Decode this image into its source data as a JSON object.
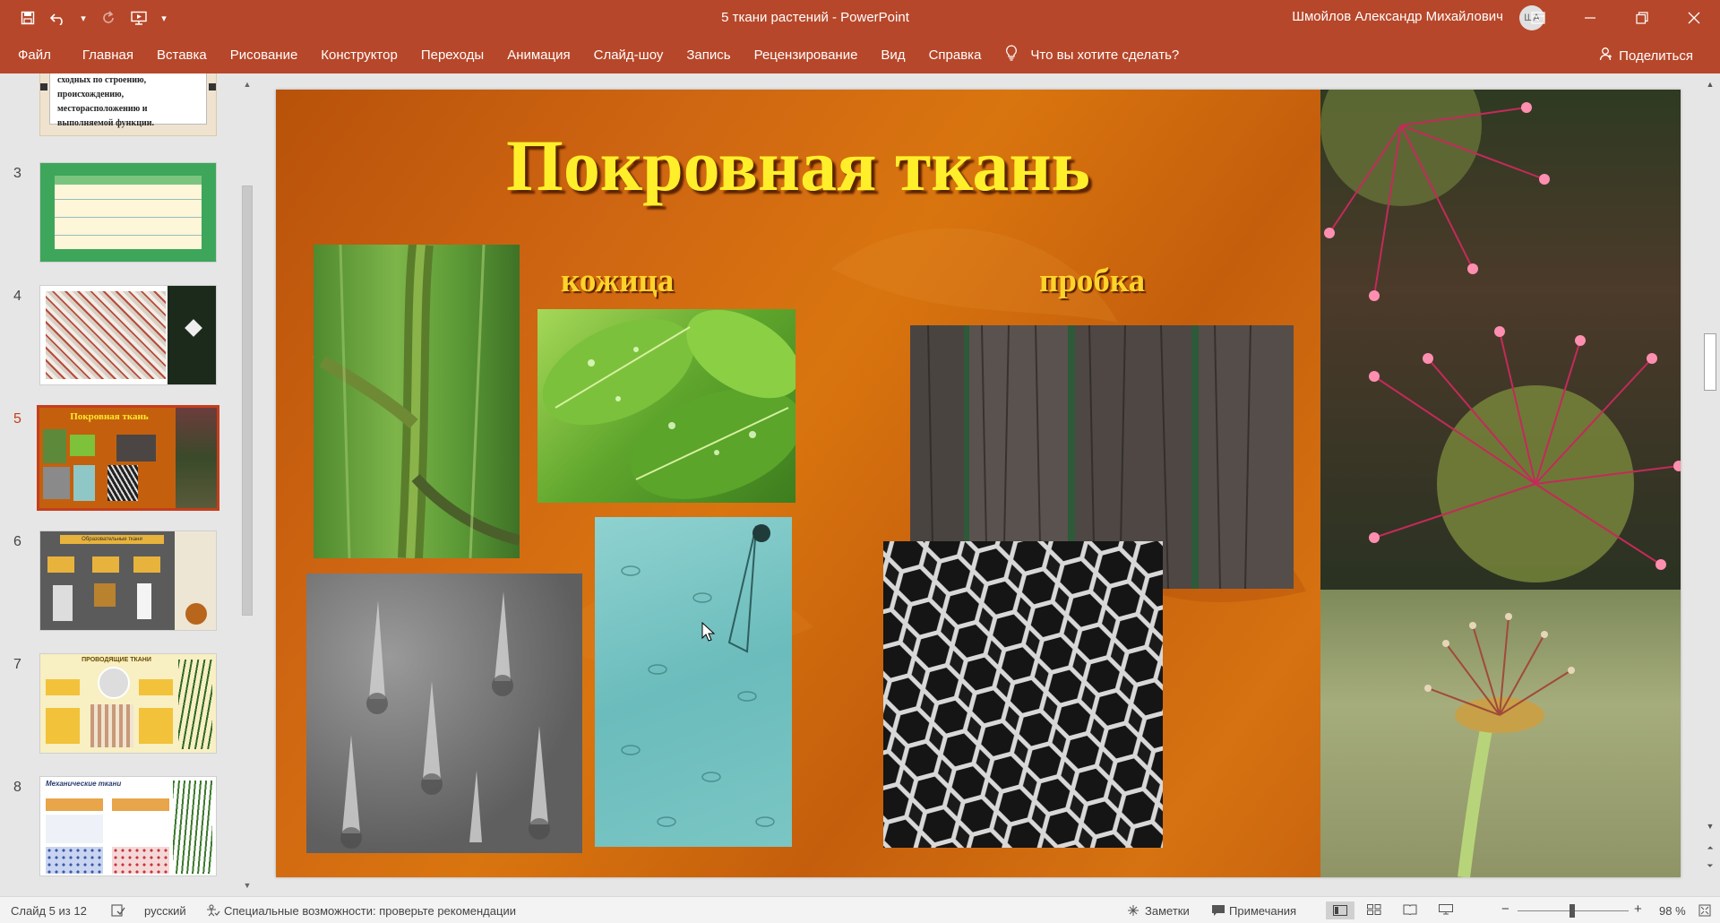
{
  "app": {
    "doc_title": "5 ткани растений  -  PowerPoint",
    "user_name": "Шмойлов Александр Михайлович",
    "user_initials": "ША"
  },
  "qat": [
    "save-icon",
    "undo-icon",
    "redo-icon",
    "slideshow-icon"
  ],
  "ribbon": {
    "tabs": [
      "Файл",
      "Главная",
      "Вставка",
      "Рисование",
      "Конструктор",
      "Переходы",
      "Анимация",
      "Слайд-шоу",
      "Запись",
      "Рецензирование",
      "Вид",
      "Справка"
    ],
    "tell_me": "Что вы хотите сделать?",
    "share": "Поделиться"
  },
  "thumbnails": {
    "partial_text": "сходных по строению, происхождению, месторасположению и выполняемой функции.",
    "slides": [
      {
        "num": "3",
        "title": "",
        "selected": false
      },
      {
        "num": "4",
        "title": "",
        "selected": false
      },
      {
        "num": "5",
        "title": "Покровная ткань",
        "selected": true
      },
      {
        "num": "6",
        "title": "Образовательные ткани",
        "selected": false
      },
      {
        "num": "7",
        "title": "ПРОВОДЯЩИЕ ТКАНИ",
        "selected": false
      },
      {
        "num": "8",
        "title": "Механические ткани",
        "selected": false
      }
    ]
  },
  "slide": {
    "title": "Покровная ткань",
    "label_left": "кожица",
    "label_right": "пробка"
  },
  "status": {
    "slide_info": "Слайд 5 из 12",
    "language": "русский",
    "accessibility": "Специальные возможности: проверьте рекомендации",
    "notes": "Заметки",
    "comments": "Примечания",
    "zoom": "98 %"
  }
}
